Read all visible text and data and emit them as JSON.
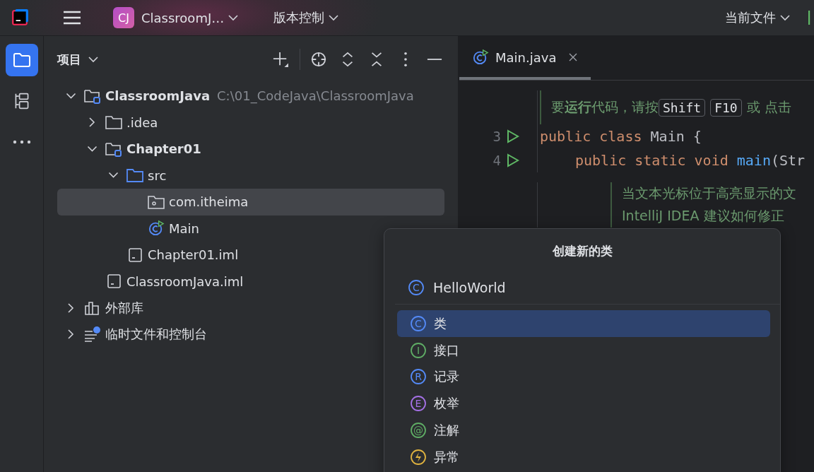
{
  "top_bar": {
    "project_badge": "CJ",
    "project_name": "ClassroomJ…",
    "vcs_menu": "版本控制",
    "run_config": "当前文件"
  },
  "tool_strip": [
    {
      "kind": "project",
      "selected": true
    },
    {
      "kind": "structure",
      "selected": false
    },
    {
      "kind": "more",
      "selected": false
    }
  ],
  "project_panel": {
    "title": "项目",
    "tree": [
      {
        "label": "ClassroomJava",
        "path": "C:\\01_CodeJava\\ClassroomJava",
        "kind": "module",
        "expanded": true,
        "selected": false,
        "children": [
          {
            "label": ".idea",
            "kind": "folder",
            "expanded": false,
            "selected": false
          },
          {
            "label": "Chapter01",
            "kind": "module",
            "expanded": true,
            "selected": false,
            "children": [
              {
                "label": "src",
                "kind": "source",
                "expanded": true,
                "selected": false,
                "children": [
                  {
                    "label": "com.itheima",
                    "kind": "package",
                    "selected": true
                  },
                  {
                    "label": "Main",
                    "kind": "class",
                    "selected": false
                  }
                ]
              },
              {
                "label": "Chapter01.iml",
                "kind": "file",
                "selected": false
              }
            ]
          },
          {
            "label": "ClassroomJava.iml",
            "kind": "file",
            "selected": false
          }
        ]
      },
      {
        "label": "外部库",
        "kind": "library",
        "expanded": false,
        "selected": false
      },
      {
        "label": "临时文件和控制台",
        "kind": "scratch",
        "expanded": false,
        "selected": false
      }
    ]
  },
  "editor": {
    "tabs": [
      {
        "label": "Main.java",
        "selected": true
      }
    ],
    "lines": [
      {
        "kind": "doc",
        "parts": [
          {
            "kind": "text",
            "text": "要**运行**代码，请按"
          },
          {
            "kind": "key",
            "text": "Shift"
          },
          {
            "kind": "key",
            "text": "F10"
          },
          {
            "kind": "text",
            "text": "或 点击"
          }
        ]
      },
      {
        "kind": "code",
        "number": "3",
        "parts": [
          {
            "kind": "keyword",
            "text": "public class "
          },
          {
            "kind": "plain",
            "text": "Main {"
          }
        ],
        "children": [
          {
            "kind": "code",
            "number": "4",
            "parts": [
              {
                "kind": "keyword",
                "text": "public static void "
              },
              {
                "kind": "function",
                "text": "main"
              },
              {
                "kind": "plain",
                "text": "(Str"
              }
            ],
            "children": [
              {
                "kind": "doc",
                "parts": [
                  {
                    "kind": "text",
                    "text": "当文本光标位于高亮显示的文"
                  }
                ]
              },
              {
                "kind": "doc",
                "parts": [
                  {
                    "kind": "text",
                    "text": "IntelliJ IDEA 建议如何修正"
                  }
                ]
              }
            ]
          }
        ]
      }
    ]
  },
  "new_class_dialog": {
    "title": "创建新的类",
    "field": {
      "glyph": "C",
      "value": "HelloWorld"
    },
    "items": [
      {
        "label": "类",
        "glyph": "C",
        "color": "#548af7",
        "selected": true
      },
      {
        "label": "接口",
        "glyph": "I",
        "color": "#5fad65",
        "selected": false
      },
      {
        "label": "记录",
        "glyph": "R",
        "color": "#548af7",
        "selected": false
      },
      {
        "label": "枚举",
        "glyph": "E",
        "color": "#a571e6",
        "selected": false
      },
      {
        "label": "注解",
        "glyph": "@",
        "color": "#5fad65",
        "selected": false
      },
      {
        "label": "异常",
        "color": "#e0b33f",
        "selected": false
      }
    ]
  }
}
